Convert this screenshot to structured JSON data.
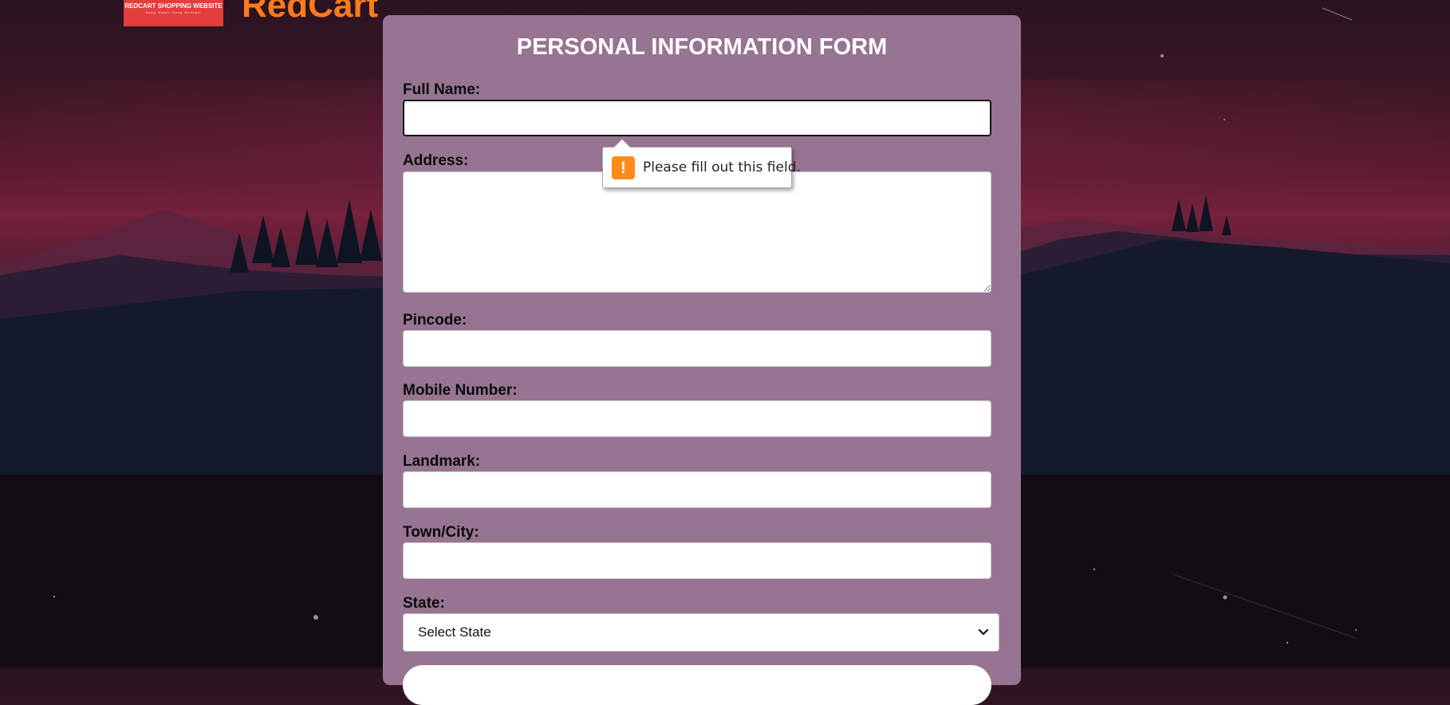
{
  "header": {
    "logo_text": "REDCART SHOPPING WEBSITE",
    "logo_tagline": "Keep Smart Keep Redcart",
    "brand_name": "RedCart"
  },
  "form": {
    "title": "PERSONAL INFORMATION FORM",
    "fields": {
      "full_name": {
        "label": "Full Name:",
        "value": ""
      },
      "address": {
        "label": "Address:",
        "value": ""
      },
      "pincode": {
        "label": "Pincode:",
        "value": ""
      },
      "mobile": {
        "label": "Mobile Number:",
        "value": ""
      },
      "landmark": {
        "label": "Landmark:",
        "value": ""
      },
      "town_city": {
        "label": "Town/City:",
        "value": ""
      },
      "state": {
        "label": "State:",
        "selected": "Select State"
      }
    }
  },
  "validation_tooltip": {
    "message": "Please fill out this field.",
    "icon": "warning-icon"
  },
  "colors": {
    "card_bg": "#977492",
    "brand": "#ff7b1c",
    "logo_bg": "#e23e3b",
    "warning": "#ff8c1a"
  }
}
